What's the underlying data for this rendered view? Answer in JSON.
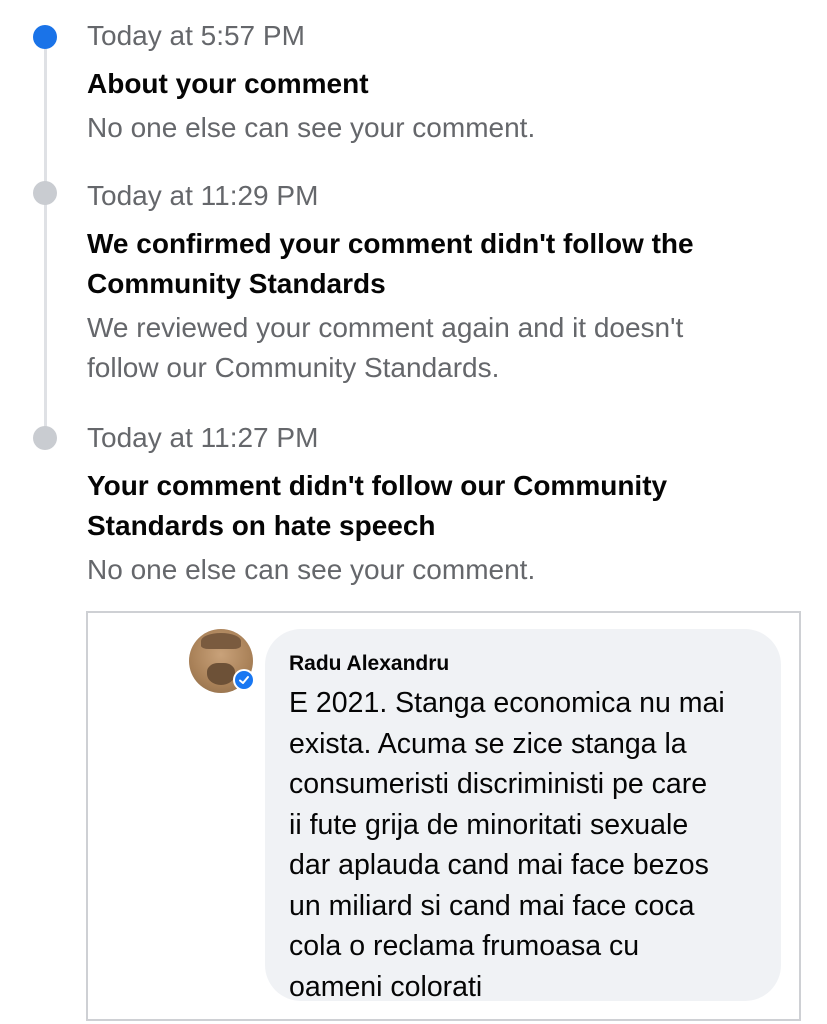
{
  "events": [
    {
      "time": "Today at 5:57 PM",
      "title": "About your comment",
      "description": "No one else can see your comment."
    },
    {
      "time": "Today at 11:29 PM",
      "title": "We confirmed your comment didn't follow the\nCommunity Standards",
      "description": "We reviewed your comment again and it doesn't\nfollow our Community Standards."
    },
    {
      "time": "Today at 11:27 PM",
      "title": "Your comment didn't follow our Community\nStandards on hate speech",
      "description": "No one else can see your comment."
    }
  ],
  "comment": {
    "author": "Radu Alexandru",
    "text": "E 2021. Stanga economica nu mai\nexista. Acuma se zice stanga la\nconsumeristi discriministi pe care\nii fute grija de minoritati sexuale\ndar aplauda cand mai face bezos\nun miliard si cand mai face coca\ncola o reclama frumoasa cu\noameni colorati"
  },
  "colors": {
    "accent": "#1a73e8",
    "inactive_dot": "#c9ccd1",
    "muted_text": "#65676b",
    "bubble": "#f0f2f5"
  },
  "icons": {
    "verified": "verified-check-icon",
    "avatar": "user-avatar"
  }
}
